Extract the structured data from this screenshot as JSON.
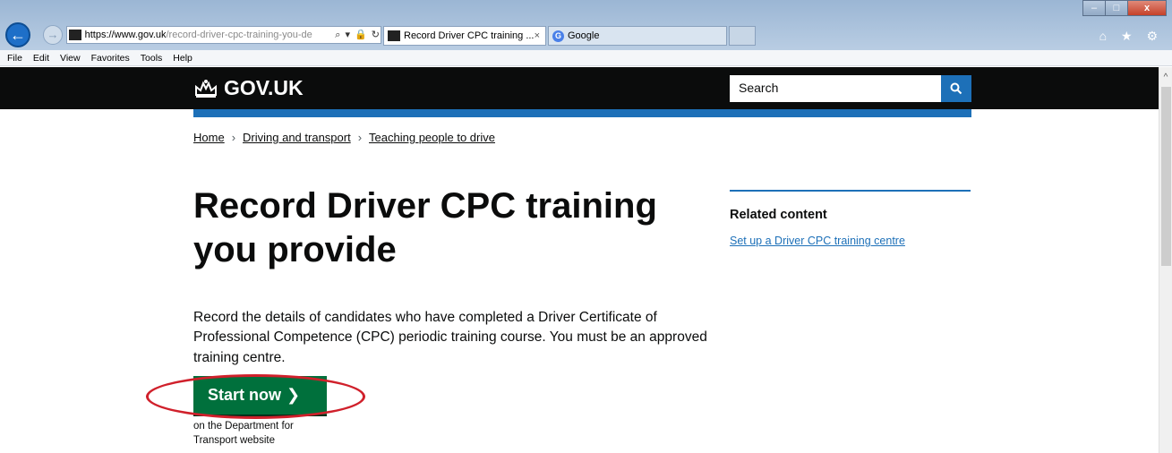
{
  "browser": {
    "url_host": "https://www.gov.uk",
    "url_path": "/record-driver-cpc-training-you-de",
    "address_tools": "⌕ ▾ 🔒 ↻",
    "tabs": [
      {
        "label": "Record Driver CPC training ...",
        "close": "×"
      },
      {
        "label": "Google"
      }
    ],
    "google_favicon": "G",
    "window_controls": {
      "minimize": "–",
      "maximize": "□",
      "close": "x"
    },
    "icons": "⌂ ★ ⚙",
    "back_glyph": "←",
    "forward_glyph": "→",
    "menu": [
      "File",
      "Edit",
      "View",
      "Favorites",
      "Tools",
      "Help"
    ]
  },
  "header": {
    "logo_text": "GOV.UK",
    "search_placeholder": "Search"
  },
  "breadcrumb": [
    "Home",
    "Driving and transport",
    "Teaching people to drive"
  ],
  "breadcrumb_separator": "›",
  "main": {
    "title": "Record Driver CPC training you provide",
    "lead": "Record the details of candidates who have completed a Driver Certificate of Professional Competence (CPC) periodic training course. You must be an approved training centre.",
    "start_button": "Start now",
    "start_chevron": "❯",
    "dept_note": "on the Department for Transport website"
  },
  "related": {
    "title": "Related content",
    "links": [
      "Set up a Driver CPC training centre"
    ]
  },
  "colors": {
    "header_bg": "#0b0c0c",
    "brand_blue": "#1d70b8",
    "start_green": "#00703c",
    "annotation_red": "#d0202b"
  }
}
